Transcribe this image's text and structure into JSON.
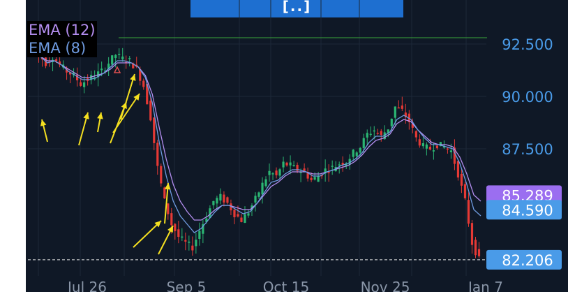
{
  "top_tab": {
    "label": "[..]"
  },
  "legend": [
    {
      "label": "EMA (12)",
      "color": "#b48ef0"
    },
    {
      "label": "EMA (8)",
      "color": "#6f9be0"
    }
  ],
  "price_badges": [
    {
      "label": "85.289",
      "value": 85.289,
      "color": "#9b6ef0"
    },
    {
      "label": "84.590",
      "value": 84.59,
      "color": "#4a9be8"
    },
    {
      "label": "82.206",
      "value": 82.206,
      "color": "#4a9be8"
    }
  ],
  "icons": {
    "annotation_arrows": "yellow-arrow-icon",
    "highlight_marker": "triangle-icon"
  },
  "chart_data": {
    "type": "candlestick",
    "x_ticks": [
      "Jul 26",
      "Sep 5",
      "Oct 15",
      "Nov 25",
      "Jan 7"
    ],
    "y_ticks": [
      "92.500",
      "90.000",
      "87.500"
    ],
    "y_tick_values": [
      92.5,
      90.0,
      87.5
    ],
    "ylim": [
      81.2,
      94.2
    ],
    "resistance_level": 92.8,
    "support_level": 82.206,
    "up_color": "#2bb673",
    "down_color": "#e53935",
    "series": [
      {
        "name": "EMA (12)",
        "color": "#b48ef0"
      },
      {
        "name": "EMA (8)",
        "color": "#6f9be0"
      }
    ],
    "close_path": [
      92.3,
      92.0,
      91.6,
      91.9,
      91.5,
      91.2,
      91.0,
      90.6,
      90.8,
      91.0,
      91.2,
      91.6,
      92.0,
      91.8,
      91.7,
      91.3,
      90.5,
      89.0,
      86.6,
      85.0,
      83.9,
      83.3,
      83.0,
      82.8,
      83.6,
      84.3,
      85.0,
      85.2,
      84.9,
      84.4,
      84.1,
      84.5,
      85.1,
      85.8,
      86.4,
      86.2,
      86.8,
      86.7,
      86.5,
      86.4,
      86.0,
      86.2,
      86.5,
      86.6,
      86.8,
      86.9,
      87.3,
      87.6,
      88.2,
      88.4,
      88.1,
      88.5,
      89.5,
      89.3,
      88.8,
      88.0,
      87.6,
      87.5,
      87.7,
      87.6,
      87.4,
      86.3,
      85.0,
      83.0,
      82.2
    ],
    "ema8_path": [
      92.2,
      91.9,
      91.6,
      91.7,
      91.5,
      91.2,
      91.0,
      90.8,
      90.8,
      90.9,
      91.1,
      91.4,
      91.7,
      91.7,
      91.6,
      91.4,
      90.9,
      89.7,
      87.8,
      86.2,
      85.0,
      84.3,
      83.9,
      83.5,
      83.7,
      84.1,
      84.5,
      84.8,
      84.8,
      84.6,
      84.4,
      84.5,
      84.9,
      85.4,
      85.9,
      86.0,
      86.3,
      86.5,
      86.5,
      86.4,
      86.2,
      86.2,
      86.4,
      86.5,
      86.7,
      86.8,
      87.0,
      87.3,
      87.8,
      88.1,
      88.1,
      88.3,
      88.9,
      89.1,
      88.9,
      88.4,
      88.0,
      87.7,
      87.7,
      87.6,
      87.5,
      86.8,
      85.8,
      84.6,
      84.3
    ],
    "ema12_path": [
      92.1,
      91.9,
      91.7,
      91.7,
      91.5,
      91.3,
      91.1,
      90.9,
      90.9,
      91.0,
      91.1,
      91.3,
      91.6,
      91.6,
      91.6,
      91.4,
      91.0,
      90.1,
      88.5,
      87.0,
      85.8,
      85.0,
      84.5,
      84.1,
      84.1,
      84.3,
      84.6,
      84.8,
      84.8,
      84.7,
      84.6,
      84.6,
      84.9,
      85.3,
      85.7,
      85.9,
      86.2,
      86.4,
      86.4,
      86.4,
      86.3,
      86.3,
      86.4,
      86.5,
      86.6,
      86.7,
      86.9,
      87.2,
      87.6,
      87.9,
      88.0,
      88.2,
      88.7,
      88.9,
      88.8,
      88.4,
      88.1,
      87.8,
      87.7,
      87.7,
      87.6,
      87.1,
      86.3,
      85.3,
      85.0
    ]
  }
}
